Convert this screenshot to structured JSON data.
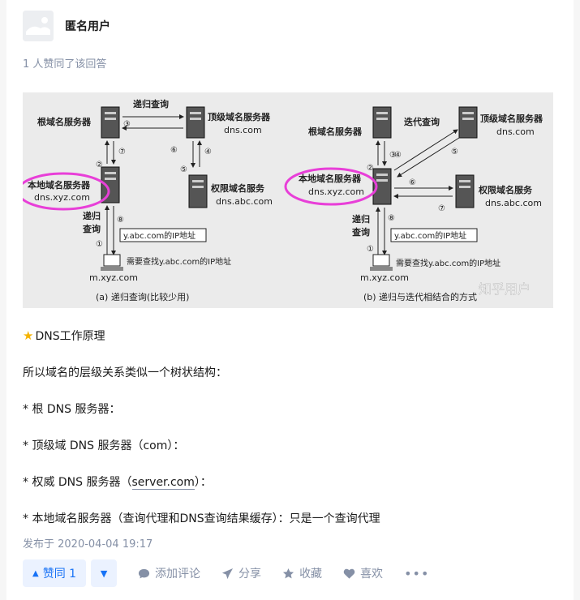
{
  "author": {
    "name": "匿名用户"
  },
  "vote_summary": "1 人赞同了该回答",
  "figure": {
    "left": {
      "root_server": "根域名服务器",
      "recursive_label": "递归查询",
      "tld_server": "顶级域名服务器",
      "tld_domain": "dns.com",
      "local_server": "本地域名服务器",
      "local_domain": "dns.xyz.com",
      "auth_server": "权限域名服务",
      "auth_domain": "dns.abc.com",
      "recursive_side_1": "递归",
      "recursive_side_2": "查询",
      "answer_box": "y.abc.com的IP地址",
      "need_text": "需要查找y.abc.com的IP地址",
      "host": "m.xyz.com",
      "caption": "(a) 递归查询(比较少用)",
      "steps": [
        "①",
        "②",
        "③",
        "④",
        "⑤",
        "⑥",
        "⑦",
        "⑧"
      ]
    },
    "right": {
      "root_server": "根域名服务器",
      "iterative_label": "迭代查询",
      "tld_server": "顶级域名服务器",
      "tld_domain": "dns.com",
      "local_server": "本地域名服务器",
      "local_domain": "dns.xyz.com",
      "auth_server": "权限域名服务",
      "auth_domain": "dns.abc.com",
      "recursive_side_1": "递归",
      "recursive_side_2": "查询",
      "answer_box": "y.abc.com的IP地址",
      "need_text": "需要查找y.abc.com的IP地址",
      "host": "m.xyz.com",
      "caption": "(b) 递归与迭代相结合的方式",
      "steps": [
        "①",
        "②",
        "③",
        "④",
        "⑤",
        "⑥",
        "⑦",
        "⑧"
      ]
    },
    "watermark": "知乎用户"
  },
  "body": {
    "heading_icon": "star-icon",
    "heading": "DNS工作原理",
    "p1": "所以域名的层级关系类似一个树状结构：",
    "p2": "* 根 DNS 服务器：",
    "p3": "* 顶级域 DNS 服务器（com）：",
    "p4_prefix": "* 权威 DNS 服务器（",
    "p4_link": "server.com",
    "p4_suffix": "）：",
    "p5": "* 本地域名服务器（查询代理和DNS查询结果缓存）：只是一个查询代理"
  },
  "published": "发布于 2020-04-04 19:17",
  "actions": {
    "upvote": "赞同 1",
    "comment": "添加评论",
    "share": "分享",
    "favorite": "收藏",
    "like": "喜欢"
  },
  "colors": {
    "accent": "#1772f6",
    "highlight_ellipse": "#e83fd8",
    "muted": "#8590a6"
  }
}
